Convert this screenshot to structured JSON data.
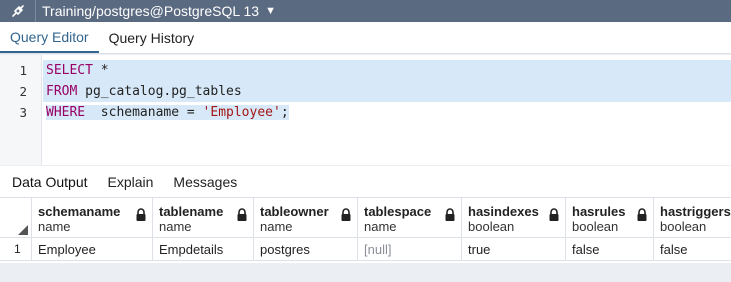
{
  "header": {
    "connection": "Training/postgres@PostgreSQL 13",
    "plug_icon": "plug-icon",
    "chevron_icon": "chevron-down-icon"
  },
  "editor_tabs": [
    "Query Editor",
    "Query History"
  ],
  "editor": {
    "line_numbers": [
      "1",
      "2",
      "3"
    ],
    "line1": {
      "kw": "SELECT",
      "rest": " *"
    },
    "line2": {
      "kw": "FROM",
      "rest": " pg_catalog.pg_tables"
    },
    "line3": {
      "kw": "WHERE",
      "rest": "  schemaname = ",
      "str": "'Employee'",
      "end": ";"
    }
  },
  "result_tabs": [
    "Data Output",
    "Explain",
    "Messages"
  ],
  "grid": {
    "columns": [
      {
        "name": "schemaname",
        "type": "name"
      },
      {
        "name": "tablename",
        "type": "name"
      },
      {
        "name": "tableowner",
        "type": "name"
      },
      {
        "name": "tablespace",
        "type": "name"
      },
      {
        "name": "hasindexes",
        "type": "boolean"
      },
      {
        "name": "hasrules",
        "type": "boolean"
      },
      {
        "name": "hastriggers",
        "type": "boolean"
      }
    ],
    "rows": [
      {
        "num": "1",
        "cells": [
          "Employee",
          "Empdetails",
          "postgres",
          "[null]",
          "true",
          "false",
          "false"
        ]
      }
    ]
  },
  "colors": {
    "header_bg": "#5a6a80",
    "accent": "#326690",
    "selection": "#d7e9f8",
    "keyword": "#990066",
    "string": "#a31515"
  }
}
